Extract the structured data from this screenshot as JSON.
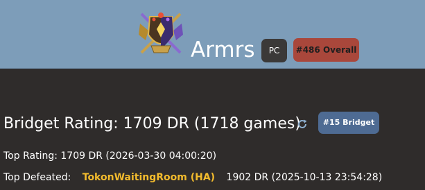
{
  "header": {
    "emblem_icon": "rank-crest-icon",
    "player_name": "Armrs",
    "platform": "PC",
    "overall_rank": "#486 Overall"
  },
  "rating": {
    "title": "Bridget Rating: 1709 DR (1718 games)",
    "refresh_icon": "refresh-icon",
    "character_rank": "#15 Bridget"
  },
  "top_rating": {
    "text": "Top Rating: 1709 DR (2026-03-30 04:00:20)"
  },
  "top_defeated": {
    "label": "Top Defeated:",
    "opponent": "TokonWaitingRoom (HA)",
    "details": "1902 DR (2025-10-13 23:54:28)"
  },
  "colors": {
    "header_bg": "#7d9db9",
    "page_bg": "#2f2c2b",
    "overall_tag": "#a9473b",
    "rank_tag": "#4e6b93",
    "opponent_link": "#f2bb2d"
  }
}
